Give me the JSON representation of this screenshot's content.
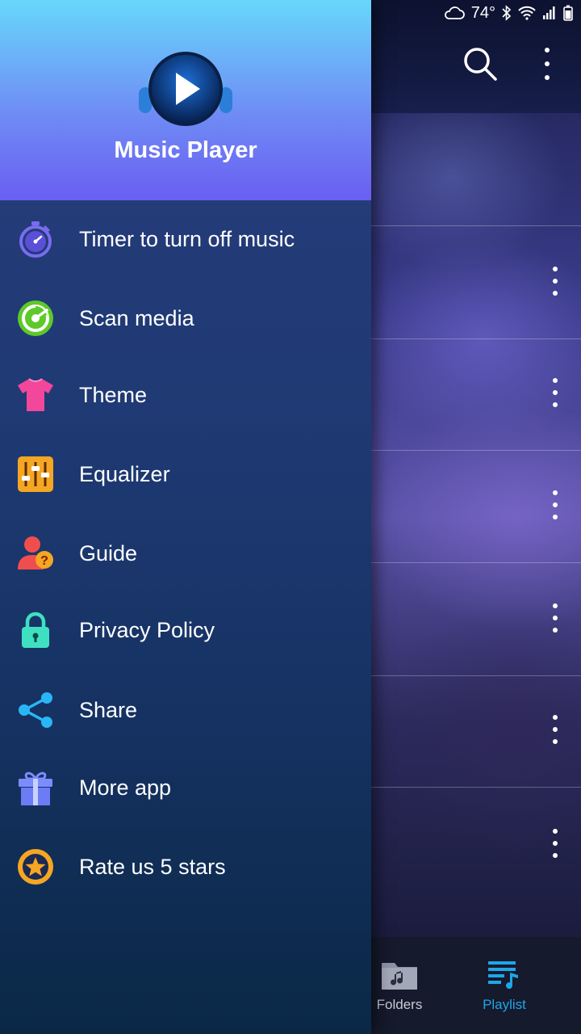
{
  "status_bar": {
    "temperature": "74",
    "degree_symbol": "°"
  },
  "drawer": {
    "app_title": "Music Player",
    "menu": [
      {
        "label": "Timer to turn off music",
        "icon": "timer-icon"
      },
      {
        "label": "Scan media",
        "icon": "scan-icon"
      },
      {
        "label": "Theme",
        "icon": "tshirt-icon"
      },
      {
        "label": "Equalizer",
        "icon": "equalizer-icon"
      },
      {
        "label": "Guide",
        "icon": "guide-icon"
      },
      {
        "label": "Privacy Policy",
        "icon": "lock-icon"
      },
      {
        "label": "Share",
        "icon": "share-icon"
      },
      {
        "label": "More app",
        "icon": "gift-icon"
      },
      {
        "label": "Rate us 5 stars",
        "icon": "star-icon"
      }
    ]
  },
  "bottom_nav": {
    "folders_label": "Folders",
    "playlist_label": "Playlist",
    "active": "Playlist"
  },
  "colors": {
    "header_top": "#67d7fb",
    "header_bottom": "#6a5ef2",
    "active_tab": "#1fa6e8"
  }
}
